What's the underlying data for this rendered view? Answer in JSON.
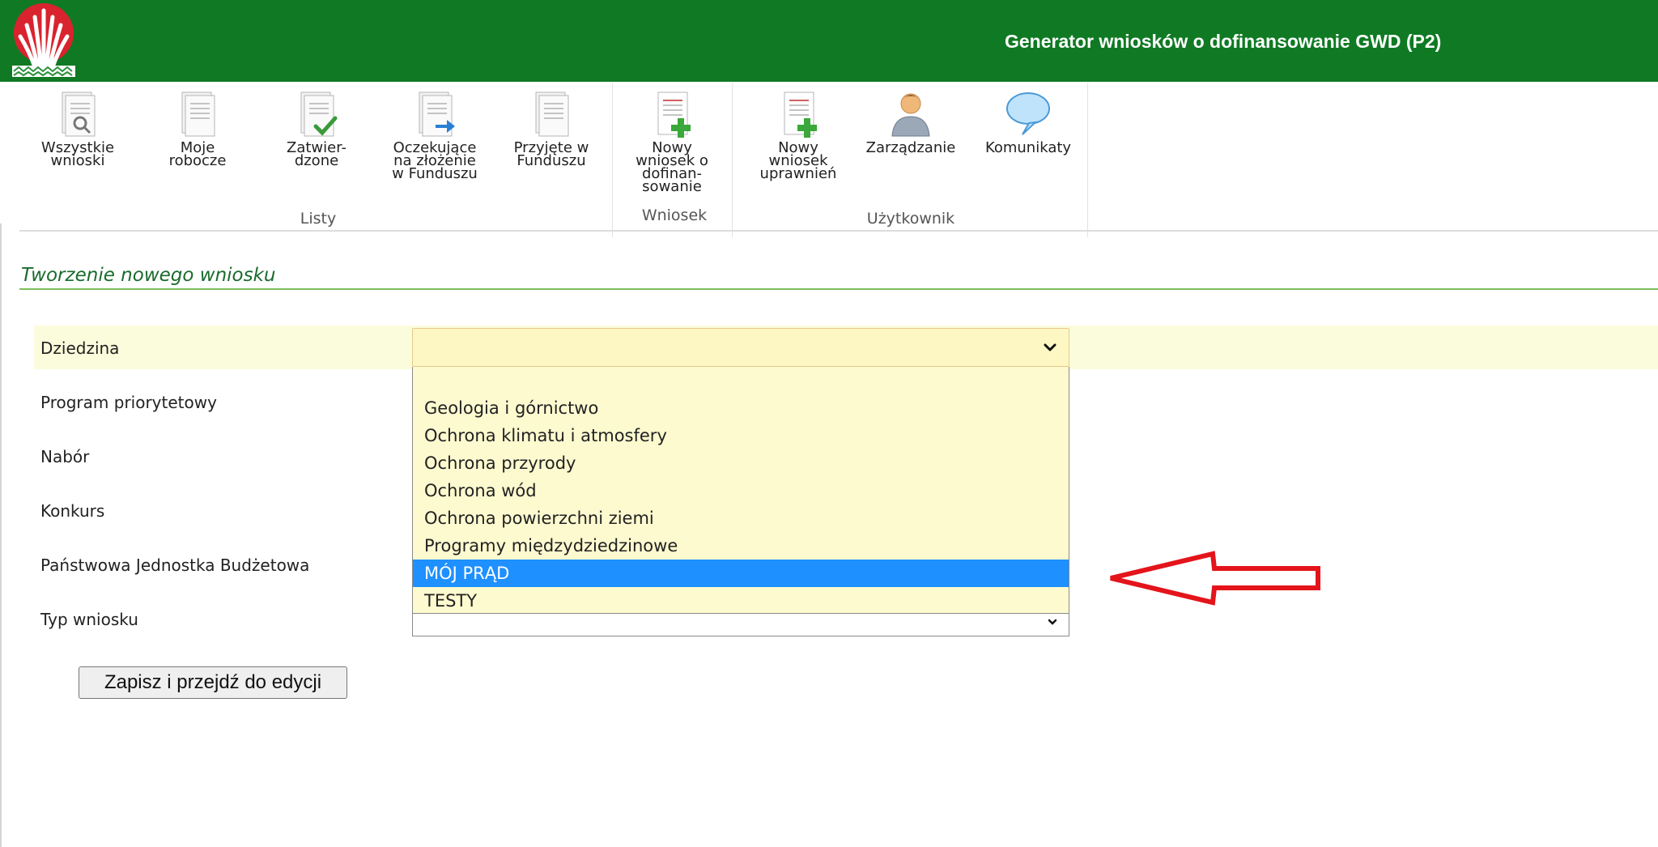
{
  "header": {
    "title": "Generator wniosków o dofinansowanie GWD (P2)"
  },
  "ribbon": {
    "buttons": [
      {
        "label": "Wszystkie\nwnioski",
        "icon": "all-requests-icon"
      },
      {
        "label": "Moje\nrobocze",
        "icon": "drafts-icon"
      },
      {
        "label": "Zatwier-\ndzone",
        "icon": "approved-icon"
      },
      {
        "label": "Oczekujące\nna złożenie\nw Funduszu",
        "icon": "pending-submit-icon"
      },
      {
        "label": "Przyjęte w\nFunduszu",
        "icon": "accepted-icon"
      },
      {
        "label": "Nowy\nwniosek o\ndofinan-\nsowanie",
        "icon": "new-request-icon"
      },
      {
        "label": "Nowy\nwniosek\nuprawnień",
        "icon": "new-permission-request-icon"
      },
      {
        "label": "Zarządzanie",
        "icon": "user-icon"
      },
      {
        "label": "Komunikaty",
        "icon": "speech-bubble-icon"
      }
    ],
    "groups": {
      "lists": "Listy",
      "request": "Wniosek",
      "user": "Użytkownik"
    }
  },
  "section": {
    "title": "Tworzenie nowego wniosku"
  },
  "form": {
    "labels": {
      "domain": "Dziedzina",
      "priority_program": "Program priorytetowy",
      "recruitment": "Nabór",
      "contest": "Konkurs",
      "budget_unit": "Państwowa Jednostka Budżetowa",
      "request_type": "Typ wniosku"
    },
    "domain_selected": "",
    "domain_options": [
      "",
      "Geologia i górnictwo",
      "Ochrona klimatu i atmosfery",
      "Ochrona przyrody",
      "Ochrona wód",
      "Ochrona powierzchni ziemi",
      "Programy międzydziedzinowe",
      "MÓJ PRĄD",
      "TESTY"
    ],
    "highlighted_option": "MÓJ PRĄD",
    "save_label": "Zapisz i przejdź do edycji"
  },
  "colors": {
    "header_bg": "#0f7a23",
    "section_title": "#1a6b2d",
    "highlight_row": "#fbfcdc",
    "selected_option": "#1e90ff",
    "arrow": "#e4141b"
  }
}
